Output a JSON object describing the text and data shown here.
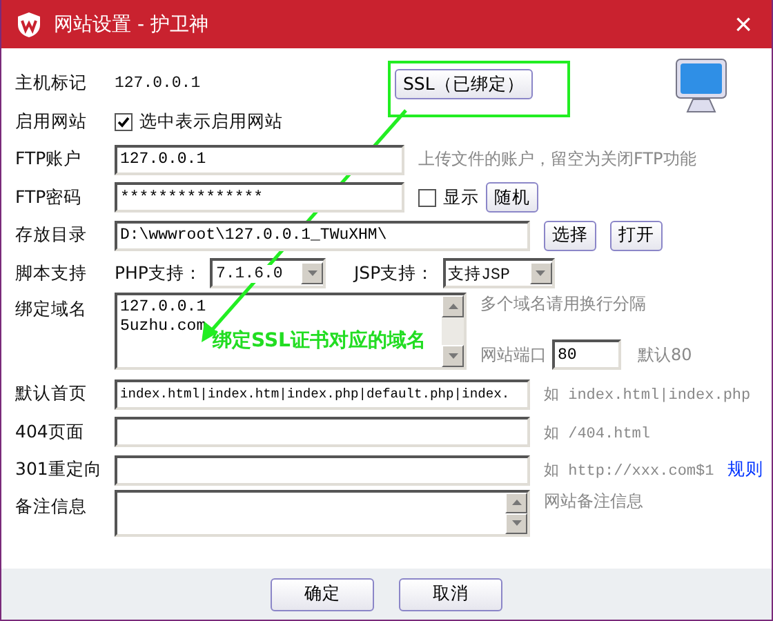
{
  "window": {
    "title": "网站设置 - 护卫神",
    "close": "×"
  },
  "host": {
    "label": "主机标记",
    "value": "127.0.0.1"
  },
  "ssl_button": {
    "label": "SSL（已绑定）"
  },
  "enable": {
    "label": "启用网站",
    "checkbox_label": "选中表示启用网站",
    "checked": true
  },
  "ftp_account": {
    "label": "FTP账户",
    "value": "127.0.0.1",
    "hint": "上传文件的账户，留空为关闭FTP功能"
  },
  "ftp_password": {
    "label": "FTP密码",
    "value": "***************",
    "show_label": "显示",
    "show_checked": false,
    "random_button": "随机"
  },
  "directory": {
    "label": "存放目录",
    "value": "D:\\wwwroot\\127.0.0.1_TWuXHM\\",
    "buttons": [
      "选择",
      "打开"
    ]
  },
  "script": {
    "label": "脚本支持",
    "php_label": "PHP支持：",
    "php_value": "7.1.6.0",
    "jsp_label": "JSP支持：",
    "jsp_value": "支持JSP"
  },
  "domains": {
    "label": "绑定域名",
    "lines": [
      "127.0.0.1",
      "5uzhu.com"
    ],
    "hint": "多个域名请用换行分隔",
    "port_label": "网站端口",
    "port_value": "80",
    "port_hint": "默认80"
  },
  "default_page": {
    "label": "默认首页",
    "value": "index.html|index.htm|index.php|default.php|index.",
    "hint": "如 index.html|index.php"
  },
  "page_404": {
    "label": "404页面",
    "hint": "如 /404.html"
  },
  "redirect_301": {
    "label": "301重定向",
    "hint": "如 http://xxx.com$1",
    "link": "规则"
  },
  "notes": {
    "label": "备注信息",
    "hint": "网站备注信息"
  },
  "annotation": {
    "text": "绑定SSL证书对应的域名"
  },
  "buttons": [
    "确定",
    "取消"
  ]
}
